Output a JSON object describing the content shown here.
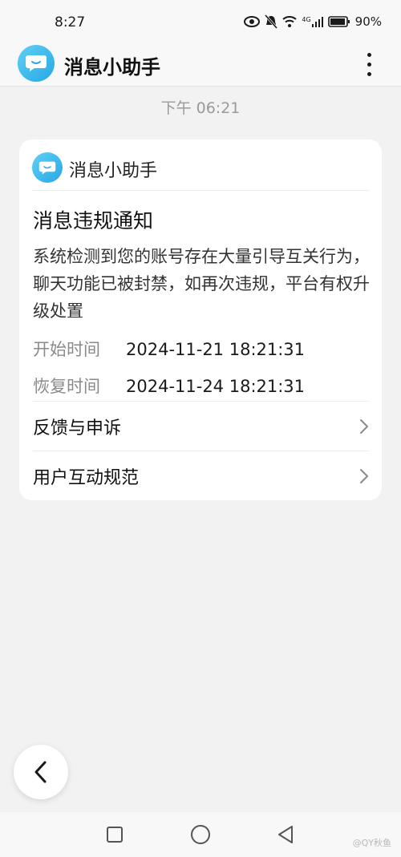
{
  "status": {
    "time": "8:27",
    "network_label": "4G",
    "battery": "90%"
  },
  "app_bar": {
    "title": "消息小助手"
  },
  "chat": {
    "timestamp": "下午 06:21"
  },
  "card": {
    "sender": "消息小助手",
    "title": "消息违规通知",
    "body": "系统检测到您的账号存在大量引导互关行为，聊天功能已被封禁，如再次违规，平台有权升级处置",
    "start_label": "开始时间",
    "start_value": "2024-11-21 18:21:31",
    "restore_label": "恢复时间",
    "restore_value": "2024-11-24 18:21:31",
    "links": [
      {
        "label": "反馈与申诉"
      },
      {
        "label": "用户互动规范"
      }
    ]
  },
  "watermark": "@QY秋鱼",
  "colors": {
    "accent": "#27a7e6",
    "background": "#f2f2f2",
    "card": "#ffffff"
  }
}
